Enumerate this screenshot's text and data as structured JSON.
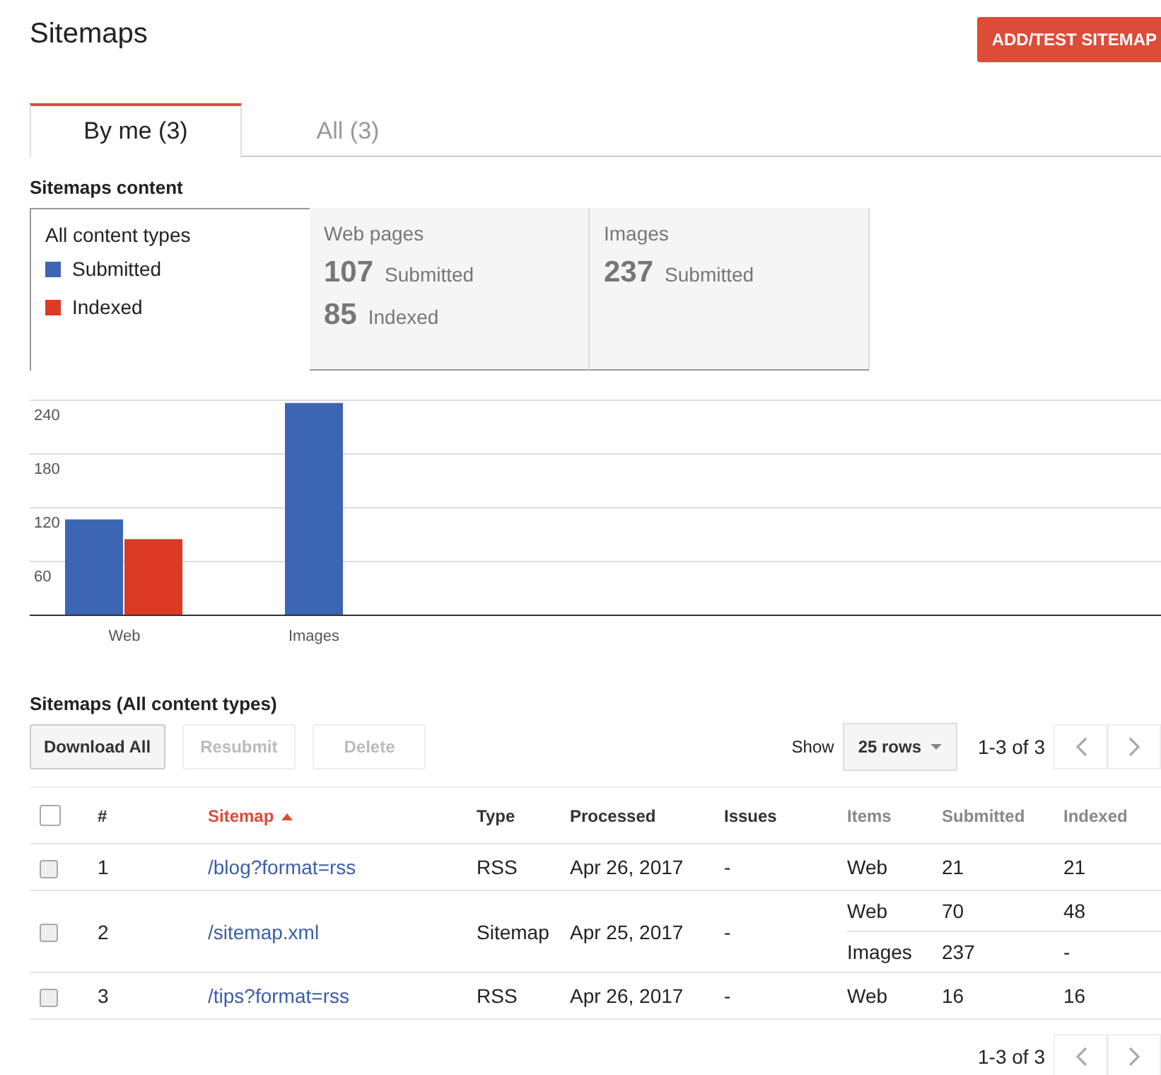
{
  "header": {
    "title": "Sitemaps",
    "action_button": "ADD/TEST SITEMAP"
  },
  "tabs": [
    {
      "label": "By me (3)",
      "selected": true
    },
    {
      "label": "All (3)",
      "selected": false
    }
  ],
  "content_section": {
    "title": "Sitemaps content",
    "cards": [
      {
        "kind": "legend",
        "title": "All content types",
        "selected": true
      },
      {
        "kind": "stats",
        "title": "Web pages",
        "selected": false,
        "stats": [
          {
            "value": "107",
            "label": "Submitted"
          },
          {
            "value": "85",
            "label": "Indexed"
          }
        ]
      },
      {
        "kind": "stats",
        "title": "Images",
        "selected": false,
        "stats": [
          {
            "value": "237",
            "label": "Submitted"
          }
        ]
      }
    ],
    "chart_data": {
      "type": "bar",
      "categories": [
        "Web",
        "Images"
      ],
      "series": [
        {
          "name": "Submitted",
          "color": "#3c65b3",
          "values": [
            107,
            237
          ]
        },
        {
          "name": "Indexed",
          "color": "#dd3a26",
          "values": [
            85,
            null
          ]
        }
      ],
      "ylim": [
        0,
        240
      ],
      "yticks": [
        60,
        120,
        180,
        240
      ],
      "grid": true
    }
  },
  "sitemaps_section": {
    "title": "Sitemaps (All content types)",
    "buttons": [
      {
        "label": "Download All",
        "disabled": false
      },
      {
        "label": "Resubmit",
        "disabled": true
      },
      {
        "label": "Delete",
        "disabled": true
      }
    ],
    "show_label": "Show",
    "rows_select": "25 rows",
    "pager_text": "1-3 of 3",
    "table": {
      "select_all_checked": false,
      "columns": [
        {
          "label": "#",
          "muted": false
        },
        {
          "label": "Sitemap",
          "muted": false,
          "sorted": true
        },
        {
          "label": "Type",
          "muted": false
        },
        {
          "label": "Processed",
          "muted": false
        },
        {
          "label": "Issues",
          "muted": false
        },
        {
          "label": "Items",
          "muted": true
        },
        {
          "label": "Submitted",
          "muted": true
        },
        {
          "label": "Indexed",
          "muted": true
        }
      ],
      "rows": [
        {
          "checked": false,
          "number": "1",
          "sitemap": "/blog?format=rss",
          "type": "RSS",
          "processed": "Apr 26, 2017",
          "issues": "-",
          "items": [
            {
              "item": "Web",
              "submitted": "21",
              "indexed": "21"
            }
          ]
        },
        {
          "checked": false,
          "number": "2",
          "sitemap": "/sitemap.xml",
          "type": "Sitemap",
          "processed": "Apr 25, 2017",
          "issues": "-",
          "items": [
            {
              "item": "Web",
              "submitted": "70",
              "indexed": "48"
            },
            {
              "item": "Images",
              "submitted": "237",
              "indexed": "-"
            }
          ]
        },
        {
          "checked": false,
          "number": "3",
          "sitemap": "/tips?format=rss",
          "type": "RSS",
          "processed": "Apr 26, 2017",
          "issues": "-",
          "items": [
            {
              "item": "Web",
              "submitted": "16",
              "indexed": "16"
            }
          ]
        }
      ]
    },
    "footer_pager_text": "1-3 of 3"
  }
}
